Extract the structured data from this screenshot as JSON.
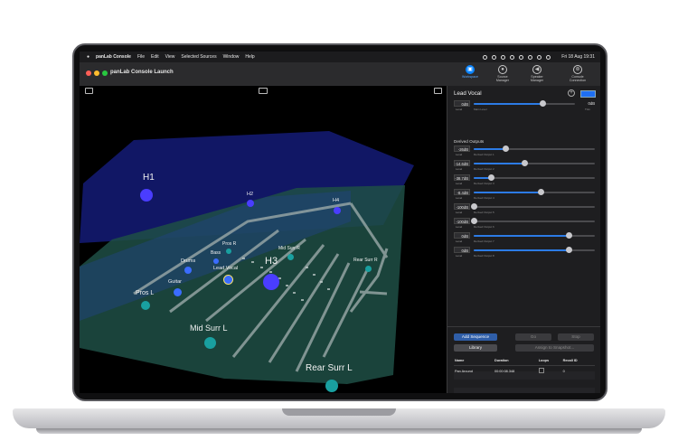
{
  "menubar": {
    "app_name": "panLab Console",
    "items": [
      "File",
      "Edit",
      "View",
      "Selected Sources",
      "Window",
      "Help"
    ],
    "datetime": "Fri 18 Aug  19:31"
  },
  "window": {
    "title": "panLab Console Launch",
    "toolbar": [
      {
        "label": "Workspace",
        "icon": "cube-icon",
        "active": true
      },
      {
        "label": "Source Manager",
        "icon": "mic-icon",
        "active": false
      },
      {
        "label": "Speaker Manager",
        "icon": "speaker-icon",
        "active": false
      },
      {
        "label": "Console Connection",
        "icon": "broadcast-icon",
        "active": false
      }
    ]
  },
  "viewport": {
    "speakers": [
      "H1",
      "H2",
      "H3",
      "H4",
      "Pros R",
      "Mid Surr R",
      "Rear Surr R",
      "Pros L",
      "Mid Surr L",
      "Rear Surr L"
    ],
    "sources": [
      "Drums",
      "Bass",
      "Lead Vocal",
      "Guitar"
    ]
  },
  "panel": {
    "source_name": "Lead Vocal",
    "accent": "#1e6ff2",
    "level": {
      "value": "0dB",
      "sub": "Level",
      "track_name": "Main Level",
      "trim": "0dB",
      "trim_sub": "Trim",
      "position": 0.68
    },
    "derived_title": "Derived Outputs",
    "derived": [
      {
        "value": "-26dB",
        "sub": "Level",
        "name": "Derived Output 1",
        "position": 0.26
      },
      {
        "value": "-14.6dB",
        "sub": "Level",
        "name": "Derived Output 2",
        "position": 0.42
      },
      {
        "value": "-38.7dB",
        "sub": "Level",
        "name": "Derived Output 3",
        "position": 0.14
      },
      {
        "value": "-8.4dB",
        "sub": "Level",
        "name": "Derived Output 4",
        "position": 0.55
      },
      {
        "value": "-100dB",
        "sub": "Level",
        "name": "Derived Output 5",
        "position": 0.0
      },
      {
        "value": "-100dB",
        "sub": "Level",
        "name": "Derived Output 6",
        "position": 0.0
      },
      {
        "value": "0dB",
        "sub": "Level",
        "name": "Derived Output 7",
        "position": 0.78
      },
      {
        "value": "0dB",
        "sub": "Level",
        "name": "Derived Output 8",
        "position": 0.78
      }
    ],
    "buttons": {
      "add_sequence": "Add Sequence",
      "go": "Go",
      "stop": "Stop",
      "library": "Library",
      "assign": "Assign to Snapshot..."
    },
    "table": {
      "headers": [
        "Name",
        "Duration",
        "Loops",
        "Recall ID"
      ],
      "rows": [
        {
          "name": "Pan Around",
          "duration": "00:00:08.348",
          "loops": "",
          "recall_id": "0"
        }
      ]
    }
  }
}
